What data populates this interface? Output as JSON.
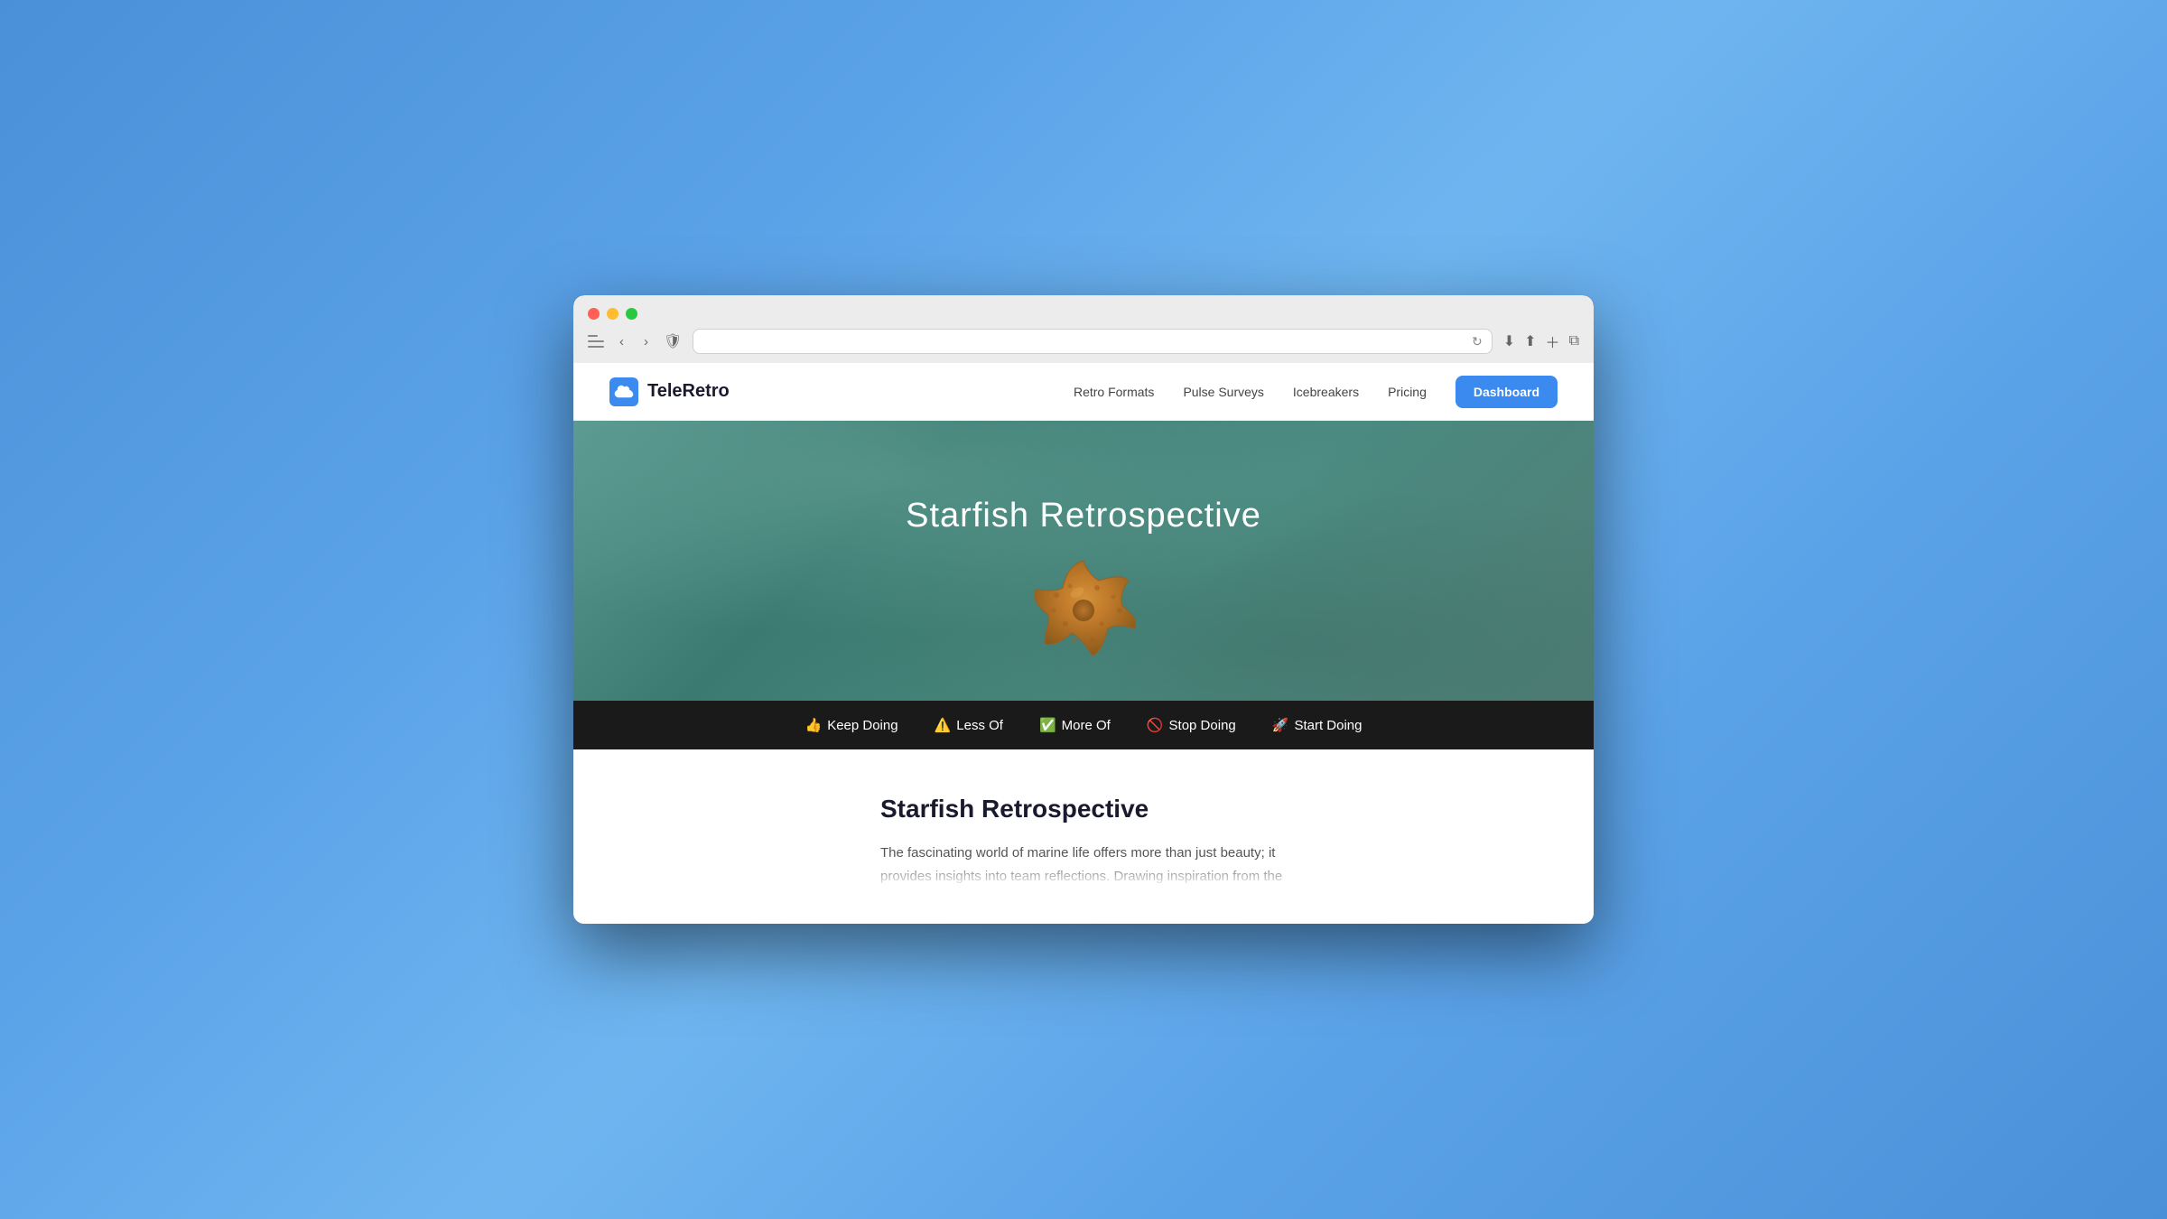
{
  "browser": {
    "traffic_lights": [
      "red",
      "yellow",
      "green"
    ],
    "address_bar": {
      "url": "",
      "placeholder": ""
    }
  },
  "nav": {
    "logo_text": "TeleRetro",
    "links": [
      {
        "label": "Retro Formats",
        "id": "retro-formats"
      },
      {
        "label": "Pulse Surveys",
        "id": "pulse-surveys"
      },
      {
        "label": "Icebreakers",
        "id": "icebreakers"
      },
      {
        "label": "Pricing",
        "id": "pricing"
      }
    ],
    "dashboard_button": "Dashboard"
  },
  "hero": {
    "title": "Starfish Retrospective"
  },
  "categories": [
    {
      "emoji": "👍",
      "label": "Keep Doing"
    },
    {
      "emoji": "⚠️",
      "label": "Less Of"
    },
    {
      "emoji": "✅",
      "label": "More Of"
    },
    {
      "emoji": "🚫",
      "label": "Stop Doing"
    },
    {
      "emoji": "🚀",
      "label": "Start Doing"
    }
  ],
  "content": {
    "title": "Starfish Retrospective",
    "body": "The fascinating world of marine life offers more than just beauty; it provides insights into team reflections. Drawing inspiration from the"
  }
}
